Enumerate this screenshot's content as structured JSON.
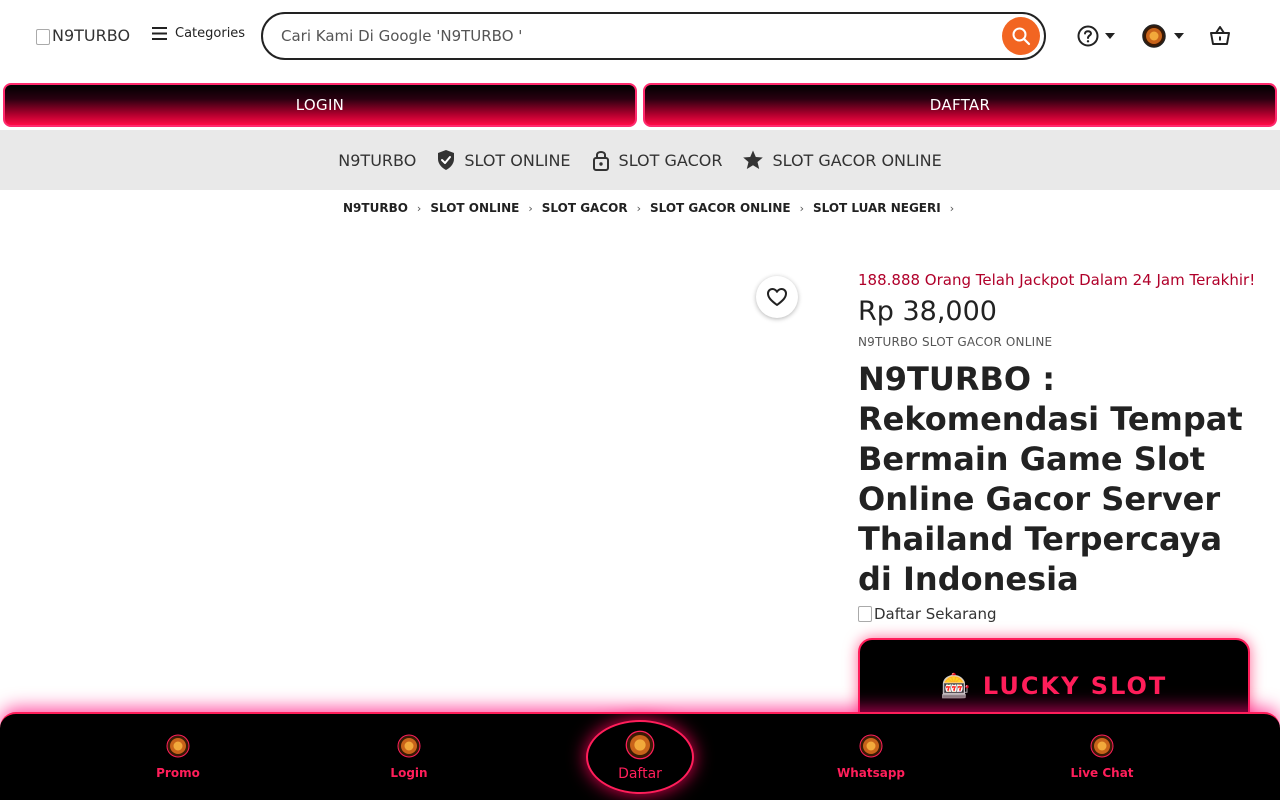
{
  "header": {
    "logo_alt": "N9TURBO",
    "categories_label": "Categories",
    "search_placeholder": "Cari Kami Di Google 'N9TURBO '"
  },
  "cta": {
    "login_label": "LOGIN",
    "daftar_label": "DAFTAR"
  },
  "nav": {
    "items": [
      {
        "label": "N9TURBO",
        "icon": "none"
      },
      {
        "label": "SLOT ONLINE",
        "icon": "shield-check-icon"
      },
      {
        "label": "SLOT GACOR",
        "icon": "lock-icon"
      },
      {
        "label": "SLOT GACOR ONLINE",
        "icon": "star-icon"
      }
    ]
  },
  "breadcrumb": [
    "N9TURBO",
    "SLOT ONLINE",
    "SLOT GACOR",
    "SLOT GACOR ONLINE",
    "SLOT LUAR NEGERI"
  ],
  "product": {
    "promo_text": "188.888 Orang Telah Jackpot Dalam 24 Jam Terakhir!",
    "price": "Rp 38,000",
    "subtitle": "N9TURBO SLOT GACOR ONLINE",
    "title": "N9TURBO : Rekomendasi Tempat Bermain Game Slot Online Gacor Server Thailand Terpercaya di Indonesia",
    "daftar_image_alt": "Daftar Sekarang",
    "lucky_label": "🎰 LUCKY SLOT"
  },
  "bottom_nav": {
    "items": [
      "Promo",
      "Login",
      "Daftar",
      "Whatsapp",
      "Live Chat"
    ]
  },
  "colors": {
    "accent": "#ff1e5a",
    "search_button": "#f26522",
    "promo_text": "#b0002a",
    "nav_bg": "#e9e9e9"
  }
}
